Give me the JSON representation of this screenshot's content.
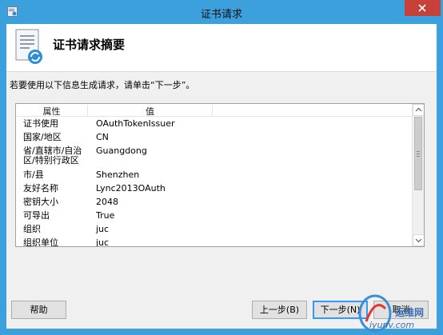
{
  "window": {
    "title": "证书请求",
    "close_label": "×"
  },
  "header": {
    "title": "证书请求摘要"
  },
  "instruction": "若要使用以下信息生成请求，请单击“下一步”。",
  "list": {
    "columns": [
      "属性",
      "值"
    ],
    "rows": [
      {
        "prop": "证书使用",
        "value": "OAuthTokenIssuer"
      },
      {
        "prop": "国家/地区",
        "value": "CN"
      },
      {
        "prop": "省/直辖市/自治区/特别行政区",
        "prop_lines": [
          "省/直辖市/自治",
          "区/特别行政区"
        ],
        "value": "Guangdong"
      },
      {
        "prop": "市/县",
        "value": "Shenzhen"
      },
      {
        "prop": "友好名称",
        "value": "Lync2013OAuth"
      },
      {
        "prop": "密钥大小",
        "value": "2048"
      },
      {
        "prop": "可导出",
        "value": "True"
      },
      {
        "prop": "组织",
        "value": "juc"
      },
      {
        "prop": "组织单位",
        "value": "juc"
      }
    ]
  },
  "buttons": {
    "help": "帮助",
    "prev": "上一步(B)",
    "next": "下一步(N)",
    "cancel": "取消"
  },
  "watermark": {
    "name": "运维网",
    "url": "iyunv.com"
  },
  "colors": {
    "titlebar": "#3ba0dc",
    "close": "#c7413b",
    "default_button_border": "#3399ff"
  }
}
